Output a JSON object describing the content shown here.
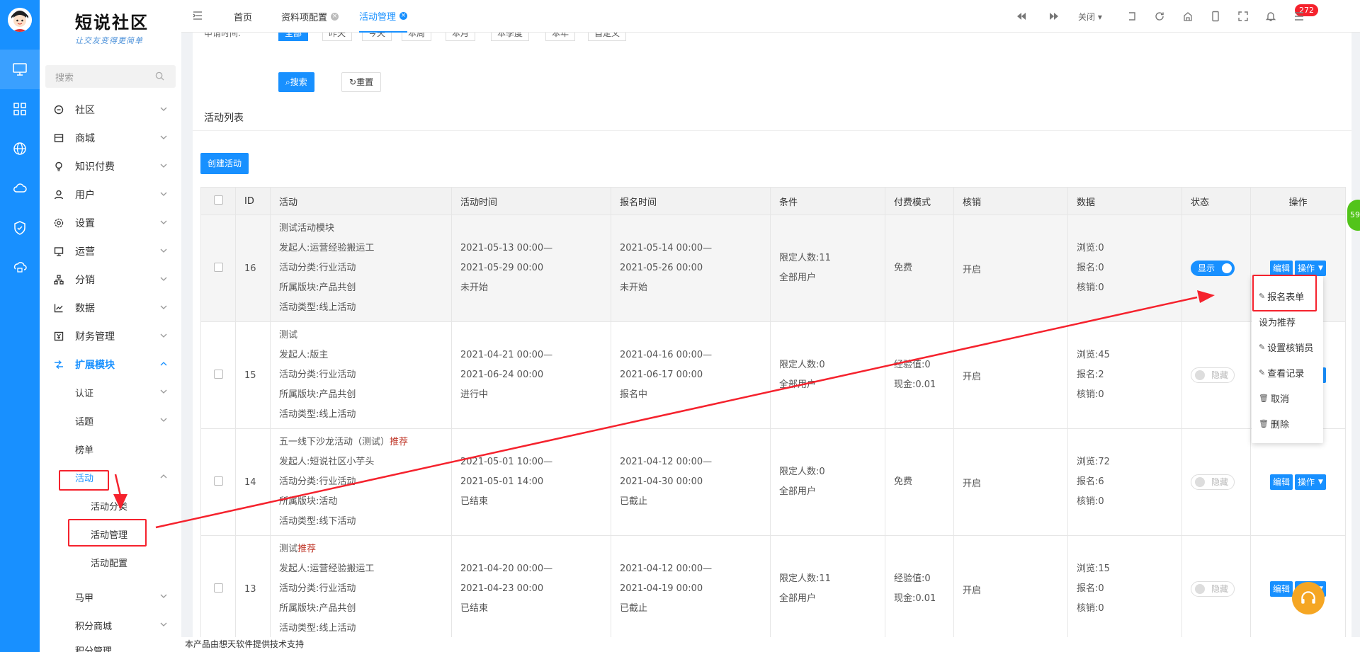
{
  "brand": {
    "name": "短说社区",
    "slogan": "让交友变得更简单"
  },
  "sidebar": {
    "search_placeholder": "搜索",
    "menu": [
      {
        "label": "社区"
      },
      {
        "label": "商城"
      },
      {
        "label": "知识付费"
      },
      {
        "label": "用户"
      },
      {
        "label": "设置"
      },
      {
        "label": "运营"
      },
      {
        "label": "分销"
      },
      {
        "label": "数据"
      },
      {
        "label": "财务管理"
      },
      {
        "label": "扩展模块"
      }
    ],
    "sub": [
      {
        "label": "认证"
      },
      {
        "label": "话题"
      },
      {
        "label": "榜单"
      },
      {
        "label": "活动"
      }
    ],
    "sub2": [
      {
        "label": "活动分类"
      },
      {
        "label": "活动管理"
      },
      {
        "label": "活动配置"
      }
    ],
    "after": [
      {
        "label": "马甲"
      },
      {
        "label": "积分商城"
      },
      {
        "label": "积分管理"
      }
    ]
  },
  "topbar": {
    "tabs": [
      {
        "label": "首页"
      },
      {
        "label": "资料项配置"
      },
      {
        "label": "活动管理"
      }
    ],
    "close_label": "关闭",
    "badge": "272"
  },
  "filter": {
    "label": "申请时间:",
    "chips": [
      "全部",
      "昨天",
      "今天",
      "本周",
      "本月",
      "本季度",
      "本年",
      "自定义"
    ],
    "search_label": "搜索",
    "reset_label": "重置"
  },
  "list": {
    "title": "活动列表",
    "create_label": "创建活动",
    "columns": [
      "ID",
      "活动",
      "活动时间",
      "报名时间",
      "条件",
      "付费模式",
      "核销",
      "数据",
      "状态",
      "操作"
    ],
    "rows": [
      {
        "id": "16",
        "activity": [
          "测试活动模块",
          "发起人:运营经验搬运工",
          "活动分类:行业活动",
          "所属版块:产品共创",
          "活动类型:线上活动"
        ],
        "tag": "",
        "time": [
          "2021-05-13 00:00—",
          "2021-05-29 00:00",
          "未开始"
        ],
        "signup": [
          "2021-05-14 00:00—",
          "2021-05-26 00:00",
          "未开始"
        ],
        "condition": [
          "限定人数:11",
          "全部用户"
        ],
        "pay": [
          "免费"
        ],
        "verify": "开启",
        "stats": [
          "浏览:0",
          "报名:0",
          "核销:0"
        ],
        "status": "显示",
        "status_on": true
      },
      {
        "id": "15",
        "activity": [
          "测试",
          "发起人:版主",
          "活动分类:行业活动",
          "所属版块:产品共创",
          "活动类型:线上活动"
        ],
        "tag": "",
        "time": [
          "2021-04-21 00:00—",
          "2021-06-24 00:00",
          "进行中"
        ],
        "signup": [
          "2021-04-16 00:00—",
          "2021-06-17 00:00",
          "报名中"
        ],
        "condition": [
          "限定人数:0",
          "全部用户"
        ],
        "pay": [
          "经验值:0",
          "现金:0.01"
        ],
        "verify": "开启",
        "stats": [
          "浏览:45",
          "报名:2",
          "核销:0"
        ],
        "status": "隐藏",
        "status_on": false
      },
      {
        "id": "14",
        "activity": [
          "五一线下沙龙活动（测试）",
          "发起人:短说社区小芋头",
          "活动分类:行业活动",
          "所属版块:活动",
          "活动类型:线下活动"
        ],
        "tag": "推荐",
        "time": [
          "2021-05-01 10:00—",
          "2021-05-01 14:00",
          "已结束"
        ],
        "signup": [
          "2021-04-12 00:00—",
          "2021-04-30 00:00",
          "已截止"
        ],
        "condition": [
          "限定人数:0",
          "全部用户"
        ],
        "pay": [
          "免费"
        ],
        "verify": "开启",
        "stats": [
          "浏览:72",
          "报名:6",
          "核销:0"
        ],
        "status": "隐藏",
        "status_on": false
      },
      {
        "id": "13",
        "activity": [
          "测试",
          "发起人:运营经验搬运工",
          "活动分类:行业活动",
          "所属版块:产品共创",
          "活动类型:线上活动"
        ],
        "tag": "推荐",
        "time": [
          "2021-04-20 00:00—",
          "2021-04-23 00:00",
          "已结束"
        ],
        "signup": [
          "2021-04-12 00:00—",
          "2021-04-19 00:00",
          "已截止"
        ],
        "condition": [
          "限定人数:11",
          "全部用户"
        ],
        "pay": [
          "经验值:0",
          "现金:0.01"
        ],
        "verify": "开启",
        "stats": [
          "浏览:15",
          "报名:0",
          "核销:0"
        ],
        "status": "隐藏",
        "status_on": false
      }
    ],
    "edit_label": "编辑",
    "op_label": "操作"
  },
  "dropdown": {
    "items": [
      "报名表单",
      "设为推荐",
      "设置核销员",
      "查看记录",
      "取消",
      "删除"
    ]
  },
  "footer": {
    "text": "本产品由想天软件提供技术支持"
  },
  "float_edge_label": "59",
  "colors": {
    "primary": "#1890ff",
    "annotation": "#f5222d"
  }
}
